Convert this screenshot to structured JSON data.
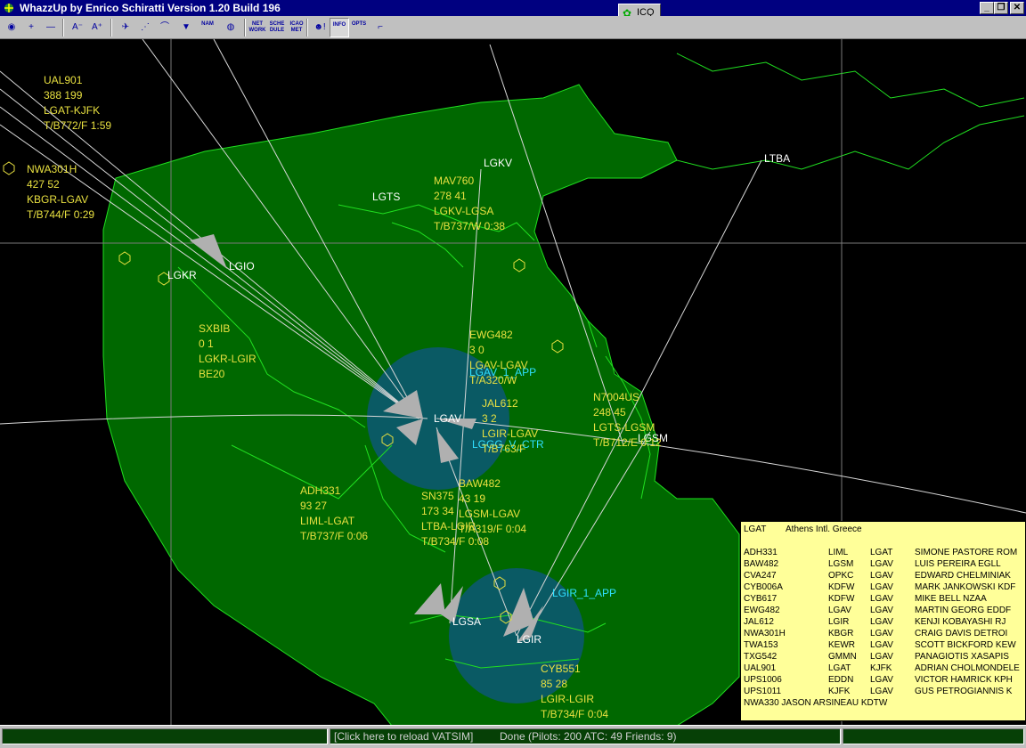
{
  "window": {
    "title": "WhazzUp by Enrico Schiratti Version 1.20 Build 196",
    "icq_label": "ICQ",
    "minimize": "_",
    "restore": "❐",
    "close": "✕"
  },
  "toolbar": {
    "buttons": [
      {
        "name": "globe-icon",
        "glyph": "◉"
      },
      {
        "name": "zoom-in-button",
        "glyph": "+"
      },
      {
        "name": "zoom-out-button",
        "glyph": "—"
      },
      {
        "name": "font-smaller-button",
        "glyph": "A⁻"
      },
      {
        "name": "font-larger-button",
        "glyph": "A⁺"
      },
      {
        "name": "aircraft-button",
        "glyph": "✈"
      },
      {
        "name": "dots-button",
        "glyph": "⋰"
      },
      {
        "name": "route-button",
        "glyph": "⌒"
      },
      {
        "name": "tower-button",
        "glyph": "▼"
      },
      {
        "name": "names-button",
        "text": "NAM"
      },
      {
        "name": "earth-button",
        "glyph": "◍"
      },
      {
        "name": "network-button",
        "text": "NET WORK"
      },
      {
        "name": "schedule-button",
        "text": "SCHE DULE"
      },
      {
        "name": "icao-met-button",
        "text": "ICAO MET"
      },
      {
        "name": "smiley-button",
        "glyph": "☻!"
      },
      {
        "name": "info-button",
        "text": "INFO"
      },
      {
        "name": "options-button",
        "text": "OPTS"
      },
      {
        "name": "help-button",
        "glyph": "⌐"
      }
    ]
  },
  "map": {
    "airports": [
      {
        "name": "airport-lgkv",
        "label": "LGKV"
      },
      {
        "name": "airport-lgts",
        "label": "LGTS"
      },
      {
        "name": "airport-ltba",
        "label": "LTBA"
      },
      {
        "name": "airport-lgio",
        "label": "LGIO"
      },
      {
        "name": "airport-lgkr",
        "label": "LGKR"
      },
      {
        "name": "airport-lgav",
        "label": "LGAV"
      },
      {
        "name": "airport-lgsm",
        "label": "LGSM"
      },
      {
        "name": "airport-lgsa",
        "label": "LGSA"
      },
      {
        "name": "airport-lgir",
        "label": "LGIR"
      }
    ],
    "atc": [
      {
        "name": "atc-lgav-1-app",
        "label": "LGAV_1_APP"
      },
      {
        "name": "atc-lggg-v-ctr",
        "label": "LGGG_V_CTR"
      },
      {
        "name": "atc-lgir-1-app",
        "label": "LGIR_1_APP"
      }
    ],
    "flights": [
      {
        "name": "flight-ual901",
        "lines": [
          "UAL901",
          "388 199",
          "LGAT-KJFK",
          "T/B772/F 1:59"
        ]
      },
      {
        "name": "flight-nwa301h",
        "lines": [
          "NWA301H",
          "427 52",
          "KBGR-LGAV",
          "T/B744/F 0:29"
        ]
      },
      {
        "name": "flight-mav760",
        "lines": [
          "MAV760",
          "278 41",
          "LGKV-LGSA",
          "T/B737/W 0:38"
        ]
      },
      {
        "name": "flight-sxbib",
        "lines": [
          "SXBIB",
          "0 1",
          "LGKR-LGIR",
          "BE20"
        ]
      },
      {
        "name": "flight-ewg482",
        "lines": [
          "EWG482",
          "3 0",
          "LGAV-LGAV",
          "T/A320/W"
        ]
      },
      {
        "name": "flight-jal612",
        "lines": [
          "JAL612",
          "3 2",
          "LGIR-LGAV",
          "T/B763/F"
        ]
      },
      {
        "name": "flight-n7004us",
        "lines": [
          "N7004US",
          "248 45",
          "LGTS-LGSM",
          "T/B712/E 0:12"
        ]
      },
      {
        "name": "flight-adh331",
        "lines": [
          "ADH331",
          "93 27",
          "LIML-LGAT",
          "T/B737/F 0:06"
        ]
      },
      {
        "name": "flight-baw482",
        "lines": [
          "BAW482",
          "43 19",
          "LGSM-LGAV",
          "T/A319/F 0:04"
        ]
      },
      {
        "name": "flight-sn375",
        "lines": [
          "SN375",
          "173 34",
          "LTBA-LGIR",
          "T/B734/F 0:08"
        ]
      },
      {
        "name": "flight-cyb551",
        "lines": [
          "CYB551",
          "85 28",
          "LGIR-LGIR",
          "T/B734/F 0:04"
        ]
      }
    ]
  },
  "info_panel": {
    "airport_code": "LGAT",
    "airport_name": "Athens Intl. Greece",
    "rows": [
      {
        "callsign": "ADH331",
        "from": "LIML",
        "to": "LGAT",
        "pilot": "SIMONE PASTORE ROM"
      },
      {
        "callsign": "BAW482",
        "from": "LGSM",
        "to": "LGAV",
        "pilot": "LUIS PEREIRA EGLL"
      },
      {
        "callsign": "CVA247",
        "from": "OPKC",
        "to": "LGAV",
        "pilot": "EDWARD CHELMINIAK"
      },
      {
        "callsign": "CYB006A",
        "from": "KDFW",
        "to": "LGAV",
        "pilot": "MARK JANKOWSKI KDF"
      },
      {
        "callsign": "CYB617",
        "from": "KDFW",
        "to": "LGAV",
        "pilot": "MIKE BELL NZAA"
      },
      {
        "callsign": "EWG482",
        "from": "LGAV",
        "to": "LGAV",
        "pilot": "MARTIN GEORG EDDF"
      },
      {
        "callsign": "JAL612",
        "from": "LGIR",
        "to": "LGAV",
        "pilot": "KENJI KOBAYASHI RJ"
      },
      {
        "callsign": "NWA301H",
        "from": "KBGR",
        "to": "LGAV",
        "pilot": "CRAIG DAVIS DETROI"
      },
      {
        "callsign": "TWA153",
        "from": "KEWR",
        "to": "LGAV",
        "pilot": "SCOTT BICKFORD KEW"
      },
      {
        "callsign": "TXG542",
        "from": "GMMN",
        "to": "LGAV",
        "pilot": "PANAGIOTIS XASAPIS"
      },
      {
        "callsign": "UAL901",
        "from": "LGAT",
        "to": "KJFK",
        "pilot": "ADRIAN CHOLMONDELE"
      },
      {
        "callsign": "UPS1006",
        "from": "EDDN",
        "to": "LGAV",
        "pilot": "VICTOR HAMRICK KPH"
      },
      {
        "callsign": "UPS1011",
        "from": "KJFK",
        "to": "LGAV",
        "pilot": "GUS PETROGIANNIS K"
      },
      {
        "callsign": "NWA330 JASON ARSINEAU KDTW",
        "from": "",
        "to": "",
        "pilot": ""
      }
    ]
  },
  "status": {
    "reload": "[Click here to reload VATSIM]",
    "done": "Done (Pilots: 200  ATC: 49  Friends: 9)"
  },
  "colors": {
    "land": "#006800",
    "coast": "#20e020",
    "approach": "#0a5a64",
    "label": "#e8e040",
    "atc_label": "#30e0ff"
  }
}
